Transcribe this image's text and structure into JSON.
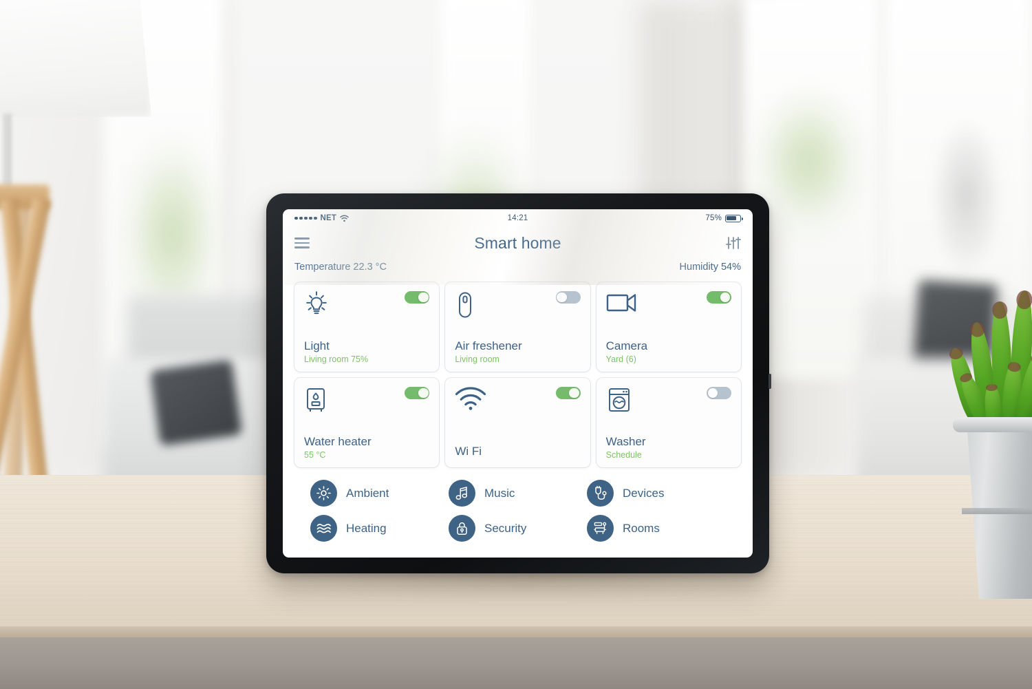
{
  "status_bar": {
    "carrier": "NET",
    "signal_dots": 5,
    "wifi_icon": "wifi-icon",
    "time": "14:21",
    "battery_percent": "75%",
    "battery_level": 75
  },
  "header": {
    "menu_icon": "hamburger-icon",
    "title": "Smart home",
    "settings_icon": "equalizer-icon"
  },
  "environment": {
    "temperature": "Temperature 22.3 °C",
    "humidity": "Humidity 54%"
  },
  "devices": [
    {
      "icon": "lightbulb-icon",
      "title": "Light",
      "subtitle": "Living room 75%",
      "toggle": "on"
    },
    {
      "icon": "air-freshener-icon",
      "title": "Air freshener",
      "subtitle": "Living room",
      "toggle": "off"
    },
    {
      "icon": "video-camera-icon",
      "title": "Camera",
      "subtitle": "Yard (6)",
      "toggle": "on"
    },
    {
      "icon": "water-heater-icon",
      "title": "Water heater",
      "subtitle": "55 °C",
      "toggle": "on"
    },
    {
      "icon": "wifi-icon",
      "title": "Wi Fi",
      "subtitle": "",
      "toggle": "on"
    },
    {
      "icon": "washer-icon",
      "title": "Washer",
      "subtitle": "Schedule",
      "toggle": "off"
    }
  ],
  "menu": [
    {
      "icon": "sun-icon",
      "label": "Ambient"
    },
    {
      "icon": "music-note-icon",
      "label": "Music"
    },
    {
      "icon": "plug-icon",
      "label": "Devices"
    },
    {
      "icon": "waves-icon",
      "label": "Heating"
    },
    {
      "icon": "lock-icon",
      "label": "Security"
    },
    {
      "icon": "furniture-icon",
      "label": "Rooms"
    }
  ],
  "colors": {
    "accent_navy": "#3d6287",
    "toggle_on": "#74bb6b",
    "toggle_off": "#b6c3ce",
    "subtitle_green": "#7ec264",
    "menu_circle": "#3f6385",
    "card_bg": "#fdfdfd"
  }
}
